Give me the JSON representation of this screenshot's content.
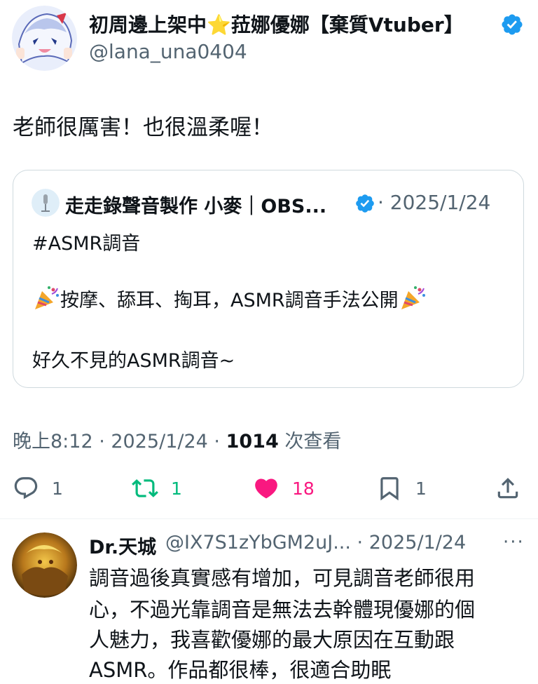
{
  "author": {
    "display_name": "初周邊上架中⭐菈娜優娜【棄質Vtuber】",
    "handle": "@lana_una0404"
  },
  "tweet": {
    "text": "老師很厲害！也很溫柔喔！"
  },
  "quote": {
    "name": "走走錄聲音製作 小麥｜OBS...",
    "date": "· 2025/1/24",
    "line1": "#ASMR調音",
    "line2": "按摩、舔耳、掏耳，ASMR調音手法公開",
    "line3": "好久不見的ASMR調音~"
  },
  "meta": {
    "time_date": "晚上8:12 · 2025/1/24 · ",
    "views_count": "1014",
    "views_label": " 次查看"
  },
  "actions": {
    "reply_count": "1",
    "retweet_count": "1",
    "like_count": "18",
    "bookmark_count": "1"
  },
  "reply": {
    "name": "Dr.天城",
    "handle_date": "@IX7S1zYbGM2uJ... · 2025/1/24",
    "more": "···",
    "line1": "調音過後真實感有增加，可見調音老師很用",
    "line2": "心，不過光靠調音是無法去幹體現優娜的個",
    "line3": "人魅力，我喜歡優娜的最大原因在互動跟",
    "line4": "ASMR。作品都很棒，很適合助眠"
  },
  "colors": {
    "verified": "#1d9bf0",
    "retweet": "#00ba7c",
    "like": "#f91880",
    "secondary_text": "#536471",
    "border": "#cfd9de"
  }
}
